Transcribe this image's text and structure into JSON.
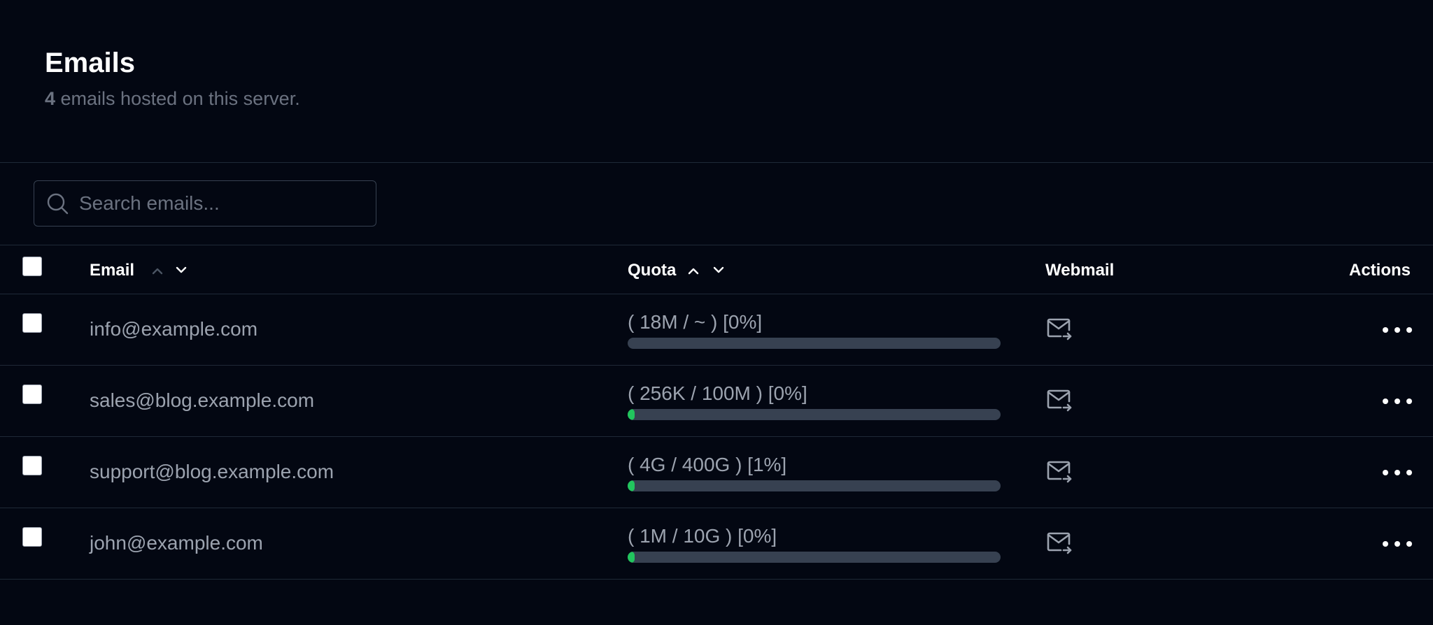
{
  "header": {
    "title": "Emails",
    "count": "4",
    "subtitle_rest": " emails hosted on this server."
  },
  "search": {
    "placeholder": "Search emails...",
    "value": "",
    "icon": "search-icon"
  },
  "table": {
    "columns": {
      "email": "Email",
      "quota": "Quota",
      "webmail": "Webmail",
      "actions": "Actions"
    },
    "rows": [
      {
        "email": "info@example.com",
        "quota": "( 18M / ~ ) [0%]",
        "usage_percent": 0
      },
      {
        "email": "sales@blog.example.com",
        "quota": "( 256K / 100M ) [0%]",
        "usage_percent": 0.26
      },
      {
        "email": "support@blog.example.com",
        "quota": "( 4G / 400G ) [1%]",
        "usage_percent": 1
      },
      {
        "email": "john@example.com",
        "quota": "( 1M / 10G ) [0%]",
        "usage_percent": 0.01
      }
    ]
  },
  "colors": {
    "background": "#030712",
    "bar_track": "#374151",
    "bar_fill": "#22c55e",
    "muted_text": "#9ca3af"
  },
  "icons": {
    "webmail": "mail-forward-icon",
    "actions": "more-horizontal-icon",
    "sort_asc": "chevron-up-icon",
    "sort_desc": "chevron-down-icon"
  }
}
